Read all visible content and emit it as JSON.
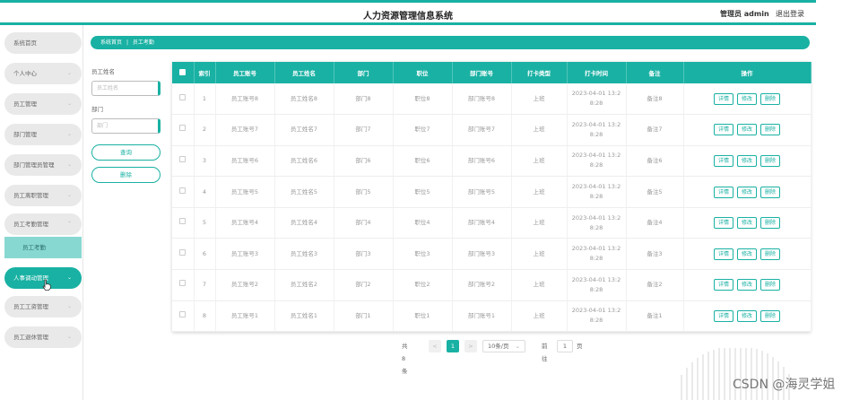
{
  "header": {
    "title": "人力资源管理信息系统",
    "admin": "管理员 admin",
    "logout": "退出登录"
  },
  "sidebar": {
    "items": [
      {
        "label": "系统首页",
        "chevron": ""
      },
      {
        "label": "个人中心",
        "chevron": "⌄"
      },
      {
        "label": "员工管理",
        "chevron": "⌄"
      },
      {
        "label": "部门管理",
        "chevron": "⌄"
      },
      {
        "label": "部门管理员管理",
        "chevron": "⌄"
      },
      {
        "label": "员工离职管理",
        "chevron": "⌄"
      },
      {
        "label": "员工考勤管理",
        "chevron": "⌃"
      },
      {
        "label": "人事调动管理",
        "chevron": "⌄"
      },
      {
        "label": "员工工资管理",
        "chevron": "⌄"
      },
      {
        "label": "员工退休管理",
        "chevron": "⌄"
      }
    ],
    "sub_item": "员工考勤",
    "accent": "#19b1a3"
  },
  "breadcrumb": {
    "home": "系统首页",
    "sep": "|",
    "current": "员工考勤"
  },
  "search": {
    "name_label": "员工姓名",
    "name_placeholder": "员工姓名",
    "dept_label": "部门",
    "dept_placeholder": "部门",
    "query_button": "查询",
    "delete_button": "删除"
  },
  "table": {
    "headers": [
      "索引",
      "员工账号",
      "员工姓名",
      "部门",
      "职位",
      "部门账号",
      "打卡类型",
      "打卡时间",
      "备注",
      "操作"
    ],
    "rows": [
      {
        "index": "1",
        "account": "员工账号8",
        "name": "员工姓名8",
        "dept": "部门8",
        "position": "职位8",
        "dept_account": "部门账号8",
        "type": "上班",
        "time": "2023-04-01 13:2 8:28",
        "remark": "备注8"
      },
      {
        "index": "2",
        "account": "员工账号7",
        "name": "员工姓名7",
        "dept": "部门7",
        "position": "职位7",
        "dept_account": "部门账号7",
        "type": "上班",
        "time": "2023-04-01 13:2 8:28",
        "remark": "备注7"
      },
      {
        "index": "3",
        "account": "员工账号6",
        "name": "员工姓名6",
        "dept": "部门6",
        "position": "职位6",
        "dept_account": "部门账号6",
        "type": "上班",
        "time": "2023-04-01 13:2 8:28",
        "remark": "备注6"
      },
      {
        "index": "4",
        "account": "员工账号5",
        "name": "员工姓名5",
        "dept": "部门5",
        "position": "职位5",
        "dept_account": "部门账号5",
        "type": "上班",
        "time": "2023-04-01 13:2 8:28",
        "remark": "备注5"
      },
      {
        "index": "5",
        "account": "员工账号4",
        "name": "员工姓名4",
        "dept": "部门4",
        "position": "职位4",
        "dept_account": "部门账号4",
        "type": "上班",
        "time": "2023-04-01 13:2 8:28",
        "remark": "备注4"
      },
      {
        "index": "6",
        "account": "员工账号3",
        "name": "员工姓名3",
        "dept": "部门3",
        "position": "职位3",
        "dept_account": "部门账号3",
        "type": "上班",
        "time": "2023-04-01 13:2 8:28",
        "remark": "备注3"
      },
      {
        "index": "7",
        "account": "员工账号2",
        "name": "员工姓名2",
        "dept": "部门2",
        "position": "职位2",
        "dept_account": "部门账号2",
        "type": "上班",
        "time": "2023-04-01 13:2 8:28",
        "remark": "备注2"
      },
      {
        "index": "8",
        "account": "员工账号1",
        "name": "员工姓名1",
        "dept": "部门1",
        "position": "职位1",
        "dept_account": "部门账号1",
        "type": "上班",
        "time": "2023-04-01 13:2 8:28",
        "remark": "备注1"
      }
    ],
    "actions": {
      "detail": "详情",
      "edit": "修改",
      "delete": "删除"
    }
  },
  "pagination": {
    "total": "共 8 条",
    "prev": "<",
    "current_page": "1",
    "next": ">",
    "page_size": "10条/页",
    "goto_label": "前往",
    "goto_value": "1",
    "page_suffix": "页"
  },
  "watermark": "CSDN @海灵学姐"
}
